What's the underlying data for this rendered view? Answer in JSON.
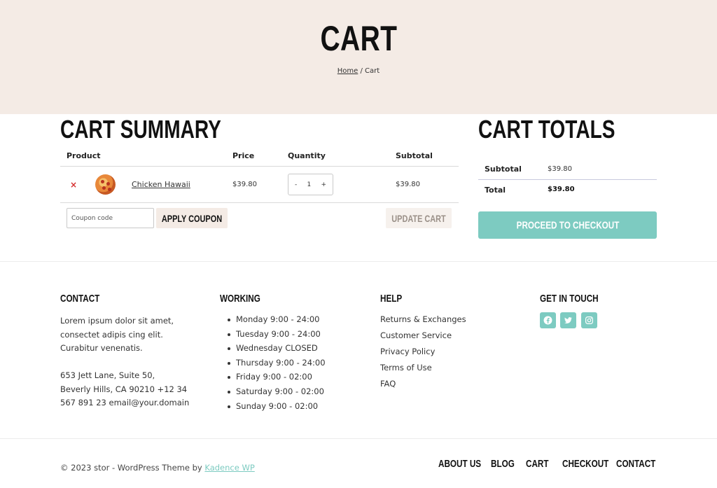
{
  "hero": {
    "title": "CART",
    "breadcrumb_home": "Home",
    "breadcrumb_sep": " / ",
    "breadcrumb_current": "Cart"
  },
  "cart_summary": {
    "heading": "CART SUMMARY",
    "columns": [
      "Product",
      "Price",
      "Quantity",
      "Subtotal"
    ],
    "items": [
      {
        "remove": "×",
        "name": "Chicken Hawaii",
        "price": "$39.80",
        "qty_minus": "-",
        "quantity": "1",
        "qty_plus": "+",
        "subtotal": "$39.80"
      }
    ],
    "coupon_placeholder": "Coupon code",
    "apply_coupon": "APPLY COUPON",
    "update_cart": "UPDATE CART"
  },
  "cart_totals": {
    "heading": "CART TOTALS",
    "subtotal_label": "Subtotal",
    "subtotal_value": "$39.80",
    "total_label": "Total",
    "total_value": "$39.80",
    "checkout": "PROCEED TO CHECKOUT"
  },
  "footer": {
    "contact": {
      "heading": "CONTACT",
      "lines": [
        "Lorem ipsum dolor sit amet,",
        "consectet adipis cing elit.",
        "Curabitur venenatis.",
        "",
        "653 Jett Lane, Suite 50,",
        "Beverly Hills, CA 90210 +12 34",
        "567 891 23 email@your.domain"
      ]
    },
    "working": {
      "heading": "WORKING",
      "hours": [
        "Monday 9:00 - 24:00",
        "Tuesday 9:00 - 24:00",
        "Wednesday CLOSED",
        "Thursday 9:00 - 24:00",
        "Friday 9:00 - 02:00",
        "Saturday 9:00 - 02:00",
        "Sunday 9:00 - 02:00"
      ]
    },
    "help": {
      "heading": "HELP",
      "links": [
        "Returns & Exchanges",
        "Customer Service",
        "Privacy Policy",
        "Terms of Use",
        "FAQ"
      ]
    },
    "social": {
      "heading": "GET IN TOUCH",
      "icons": [
        "facebook-icon",
        "twitter-icon",
        "instagram-icon"
      ],
      "color": "#7dcbc1"
    },
    "copyright_prefix": "© 2023 stor - WordPress Theme by ",
    "copyright_link": "Kadence WP",
    "nav": [
      "ABOUT US",
      "BLOG",
      "CART",
      "CHECKOUT",
      "CONTACT"
    ]
  },
  "colors": {
    "hero_bg": "#f4ebe5",
    "accent": "#7dcbc1",
    "remove": "#d63030"
  }
}
